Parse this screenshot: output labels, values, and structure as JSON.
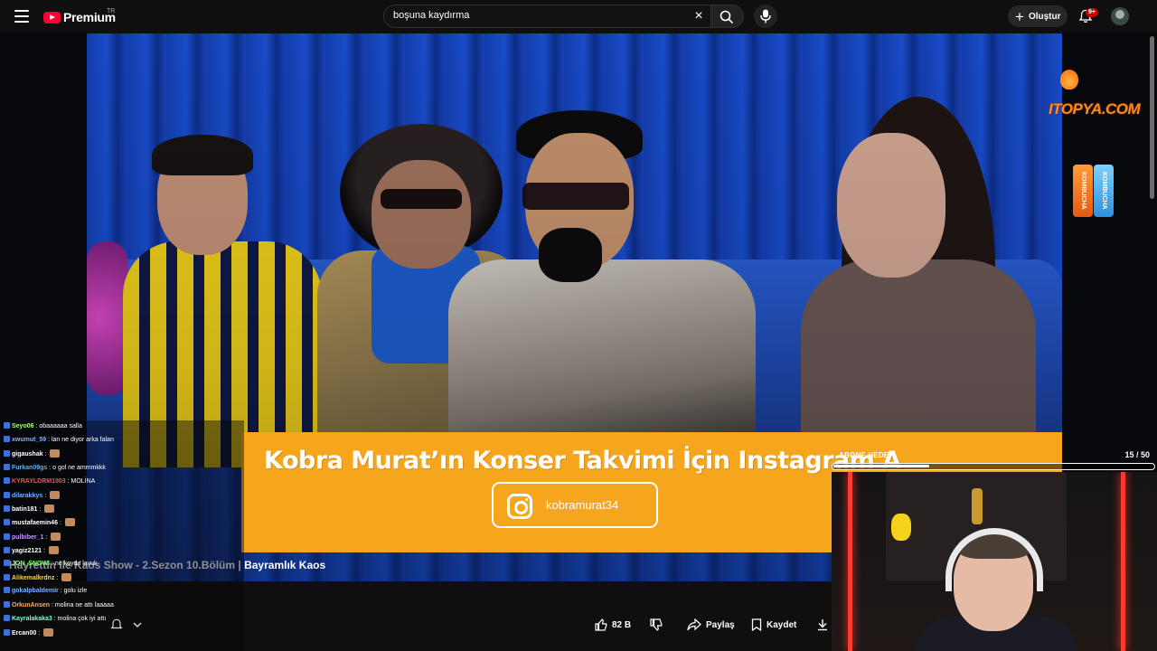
{
  "header": {
    "logo_text": "Premium",
    "country_code": "TR",
    "search_value": "boşuna kaydırma",
    "create_label": "Oluştur",
    "notification_count": "9+"
  },
  "video": {
    "title": "Hayrettin ile Kaos Show - 2.Sezon 10.Bölüm | Bayramlık Kaos",
    "promo_text": "Kobra Murat’ın Konser Takvimi İçin Instagram A",
    "instagram_handle": "kobramurat34",
    "brand_text": "ITOPYA.COM",
    "can_left": "KOMBUCHA",
    "can_right": "KOMBUCHA"
  },
  "actions": {
    "like_count": "82 B",
    "share_label": "Paylaş",
    "save_label": "Kaydet"
  },
  "chat": {
    "messages": [
      {
        "user": "Seyo06",
        "text": "obaaaaaa salla",
        "color": "#a5ff7a"
      },
      {
        "user": "xwumut_59",
        "text": "lan ne diyor arka falan",
        "color": "#7fb2ff"
      },
      {
        "user": "gigaushak",
        "text": "",
        "color": "#ffffff"
      },
      {
        "user": "Furkan09gs",
        "text": "o gol ne ammmkkk",
        "color": "#4fb4ff"
      },
      {
        "user": "KYRAYLDRM1903",
        "text": "MOLİNA",
        "color": "#ff4a4a"
      },
      {
        "user": "dilarakkys",
        "text": "",
        "color": "#7fb2ff"
      },
      {
        "user": "batin181",
        "text": "",
        "color": "#ffffff"
      },
      {
        "user": "mustafaemin46",
        "text": "",
        "color": "#ffffff"
      },
      {
        "user": "pulbiber_1",
        "text": "",
        "color": "#c59cff"
      },
      {
        "user": "yagiz2121",
        "text": "",
        "color": "#ffffff"
      },
      {
        "user": "JON_SNOWI",
        "text": "ne koydu lavuk",
        "color": "#7dff7d"
      },
      {
        "user": "Alikemalkrdnz",
        "text": "",
        "color": "#ffd54a"
      },
      {
        "user": "gokalpbaldemir",
        "text": "golu izle",
        "color": "#7fb2ff"
      },
      {
        "user": "OrkunAnsen",
        "text": "molina ne attı laaaaa",
        "color": "#ffae5a"
      },
      {
        "user": "Kayralakaka3",
        "text": "molina çok iyi attı",
        "color": "#7fffd9"
      },
      {
        "user": "Ercan00",
        "text": "",
        "color": "#ffffff"
      }
    ]
  },
  "sub_goal": {
    "label": "ABONE HEDEFİ",
    "current": 15,
    "target": 50,
    "count_text": "15 / 50"
  },
  "icons": [
    "menu-icon",
    "youtube-logo-icon",
    "close-icon",
    "search-icon",
    "mic-icon",
    "plus-icon",
    "bell-icon",
    "avatar",
    "thumbs-up-icon",
    "thumbs-down-icon",
    "share-icon",
    "save-icon",
    "download-icon",
    "instagram-icon",
    "chevron-down-icon"
  ]
}
